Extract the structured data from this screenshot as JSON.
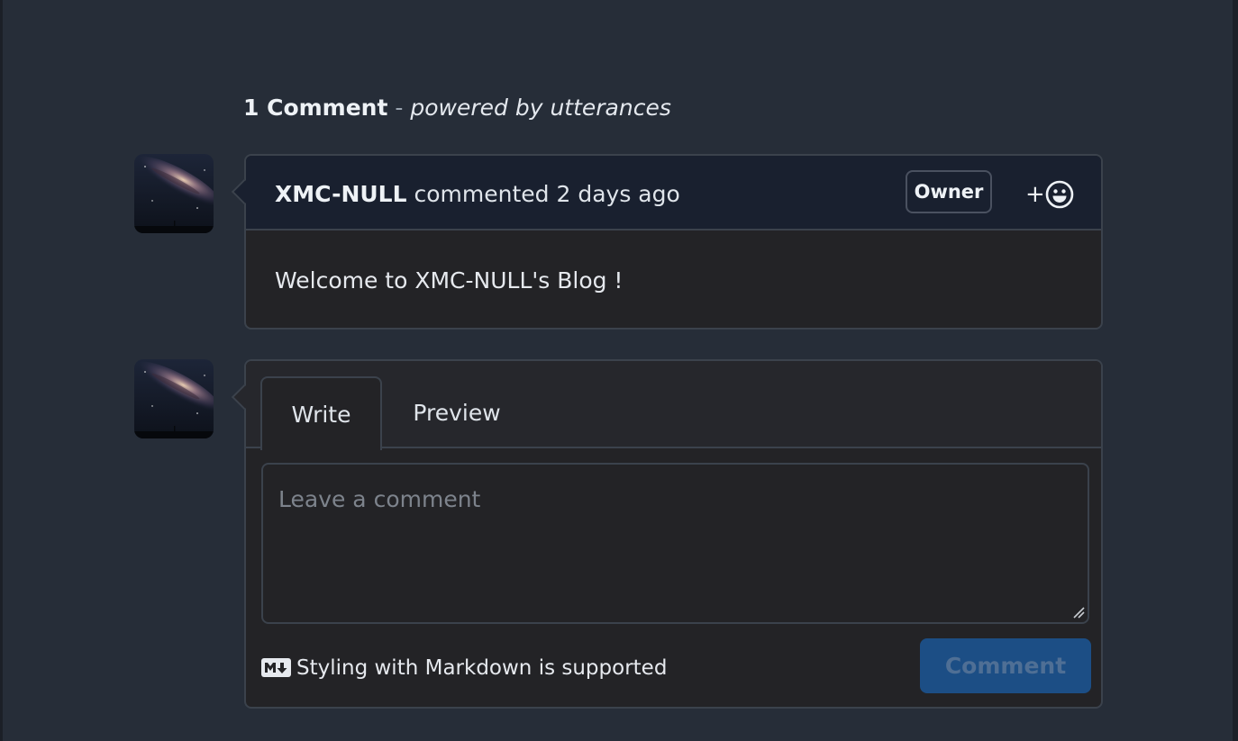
{
  "header": {
    "count_label": "1 Comment",
    "separator": "-",
    "powered_by": "powered by utterances"
  },
  "comment": {
    "avatar_icon": "user-avatar-milky-way",
    "author": "XMC-NULL",
    "action": "commented",
    "time": "2 days ago",
    "badge": "Owner",
    "reaction_label": "+",
    "reaction_icon": "smiley-icon",
    "body": "Welcome to XMC-NULL's Blog !"
  },
  "editor": {
    "avatar_icon": "user-avatar-milky-way",
    "tabs": [
      {
        "label": "Write",
        "active": true
      },
      {
        "label": "Preview",
        "active": false
      }
    ],
    "placeholder": "Leave a comment",
    "value": "",
    "markdown_note": "Styling with Markdown is supported",
    "markdown_icon": "markdown-icon",
    "submit_label": "Comment",
    "submit_disabled": true
  },
  "colors": {
    "page_bg": "#262d38",
    "card_bg": "#232326",
    "comment_header_bg": "#19202f",
    "border": "#3b424c",
    "primary_button": "#1c4e85",
    "primary_button_text_disabled": "#4f6f95"
  }
}
